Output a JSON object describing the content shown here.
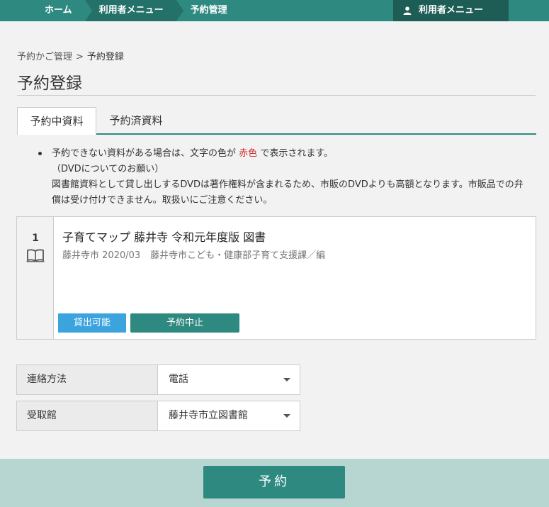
{
  "nav": {
    "crumbs": [
      "ホーム",
      "利用者メニュー",
      "予約管理"
    ],
    "user_menu": "利用者メニュー",
    "user_icon": "user-icon"
  },
  "breadcrumb": {
    "parent": "予約かご管理",
    "separator": ">",
    "current": "予約登録"
  },
  "page_title": "予約登録",
  "tabs": [
    "予約中資料",
    "予約済資料"
  ],
  "notice": {
    "line1_before": "予約できない資料がある場合は、文字の色が",
    "line1_red": "赤色",
    "line1_after": "で表示されます。",
    "line2": "（DVDについてのお願い）",
    "line3": "図書館資料として貸し出しするDVDは著作権料が含まれるため、市販のDVDよりも高額となります。市販品での弁償は受け付けできません。取扱いにご注意ください。"
  },
  "item": {
    "number": "1",
    "type_icon": "book-icon",
    "title": "子育てマップ 藤井寺 令和元年度版 図書",
    "publisher": "藤井寺市",
    "date": "2020/03",
    "author": "藤井寺市こども・健康部子育て支援課／編",
    "status": "貸出可能",
    "cancel_label": "予約中止"
  },
  "form": {
    "contact_label": "連絡方法",
    "contact_value": "電話",
    "pickup_label": "受取館",
    "pickup_value": "藤井寺市立図書館"
  },
  "submit_label": "予約",
  "colors": {
    "primary": "#2e8a80",
    "dark": "#1e5d56",
    "available": "#3ba3dd",
    "bottom_bar": "#b8d6d1",
    "warning_red": "#d0312d"
  }
}
